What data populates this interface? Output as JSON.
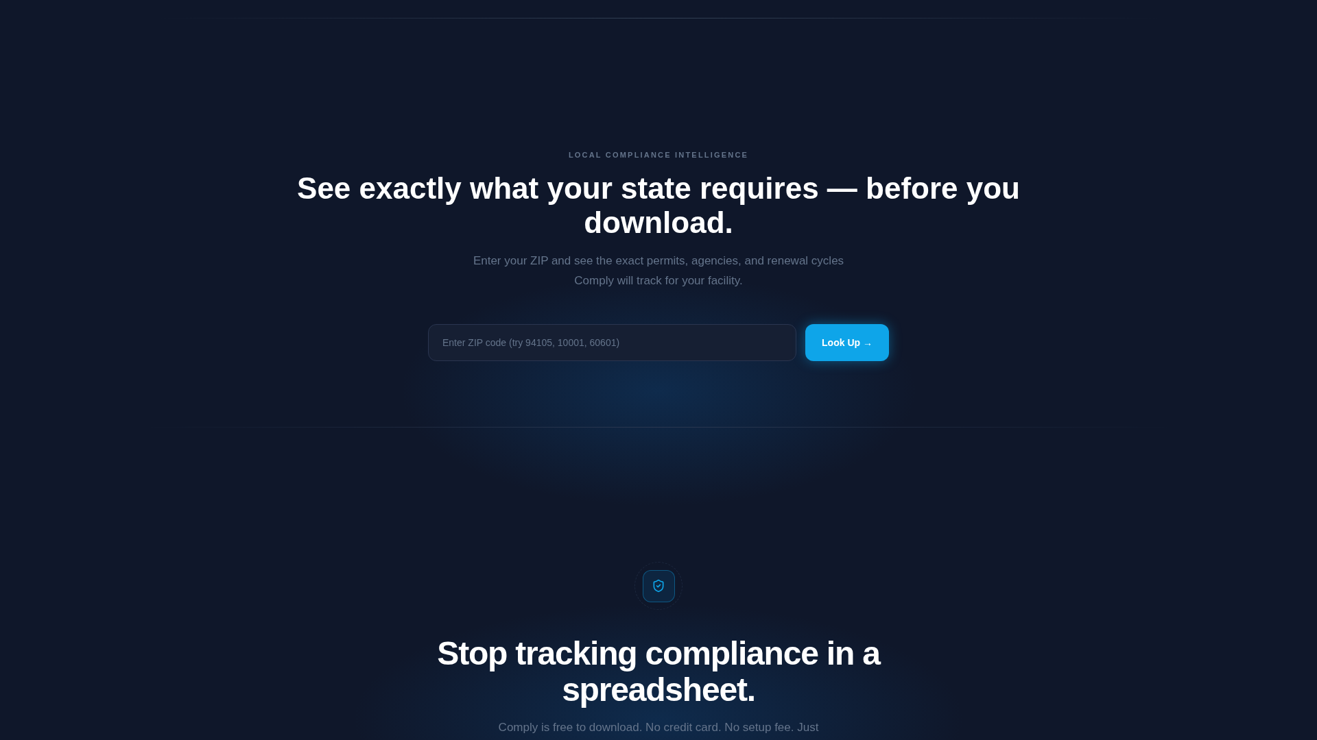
{
  "hero": {
    "eyebrow": "LOCAL COMPLIANCE INTELLIGENCE",
    "heading": "See exactly what your state requires — before you download.",
    "subtitle": "Enter your ZIP and see the exact permits, agencies, and renewal cycles Comply will track for your facility.",
    "zip_field": {
      "placeholder": "Enter ZIP code (try 94105, 10001, 60601)"
    },
    "button": "Look Up →"
  },
  "cta": {
    "heading": "Stop tracking compliance in a spreadsheet.",
    "text": "Comply is free to download. No credit card. No setup fee. Just"
  }
}
